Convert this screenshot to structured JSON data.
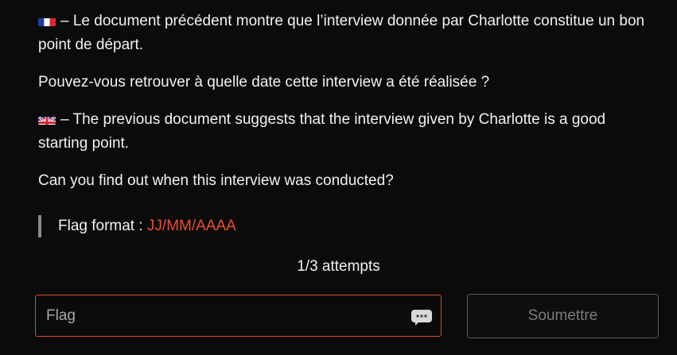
{
  "challenge": {
    "fr": {
      "flag_icon": "france-flag-icon",
      "line1": "– Le document précédent montre que l’interview donnée par Charlotte constitue un bon point de départ.",
      "line2": "Pouvez-vous retrouver à quelle date cette interview a été réalisée ?"
    },
    "en": {
      "flag_icon": "uk-flag-icon",
      "line1": "– The previous document suggests that the interview given by Charlotte is a good starting point.",
      "line2": "Can you find out when this interview was conducted?"
    },
    "flag_format_label": "Flag format : ",
    "flag_format_value": "JJ/MM/AAAA"
  },
  "attempts": "1/3 attempts",
  "flag_input": {
    "placeholder": "Flag",
    "value": ""
  },
  "submit_label": "Soumettre",
  "colors": {
    "background": "#0b0b0b",
    "accent": "#f04d2a",
    "input_border": "#e0482a",
    "button_border": "#5c5c5c"
  }
}
